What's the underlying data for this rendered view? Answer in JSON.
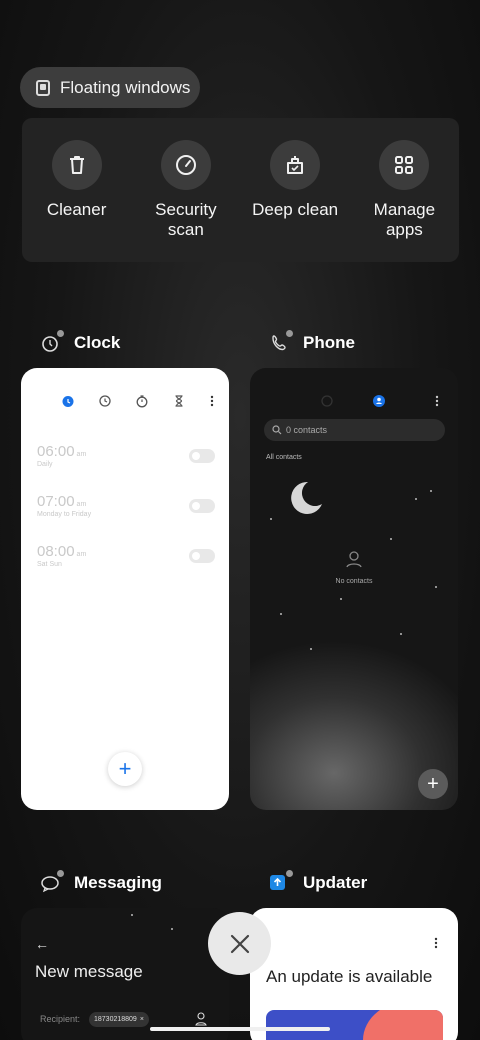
{
  "floating": {
    "label": "Floating windows"
  },
  "tools": [
    {
      "label": "Cleaner",
      "icon": "trash-icon"
    },
    {
      "label": "Security scan",
      "icon": "security-gauge-icon"
    },
    {
      "label": "Deep clean",
      "icon": "deep-clean-icon"
    },
    {
      "label": "Manage apps",
      "icon": "grid-apps-icon"
    }
  ],
  "apps": {
    "clock": {
      "title": "Clock",
      "alarms": [
        {
          "time": "06:00",
          "ampm": "am",
          "repeat": "Daily"
        },
        {
          "time": "07:00",
          "ampm": "am",
          "repeat": "Monday to Friday"
        },
        {
          "time": "08:00",
          "ampm": "am",
          "repeat": "Sat Sun"
        }
      ],
      "fab": "+"
    },
    "phone": {
      "title": "Phone",
      "search_placeholder": "0 contacts",
      "filter": "All contacts",
      "empty": "No contacts",
      "fab": "+"
    },
    "messaging": {
      "title": "Messaging",
      "header": "New message",
      "recipient_label": "Recipient:",
      "recipient_chip": "18730218809"
    },
    "updater": {
      "title": "Updater",
      "headline": "An update is available"
    }
  },
  "colors": {
    "accent": "#1a73e8",
    "updater_blue": "#3d4fc7",
    "updater_coral": "#f07068"
  }
}
